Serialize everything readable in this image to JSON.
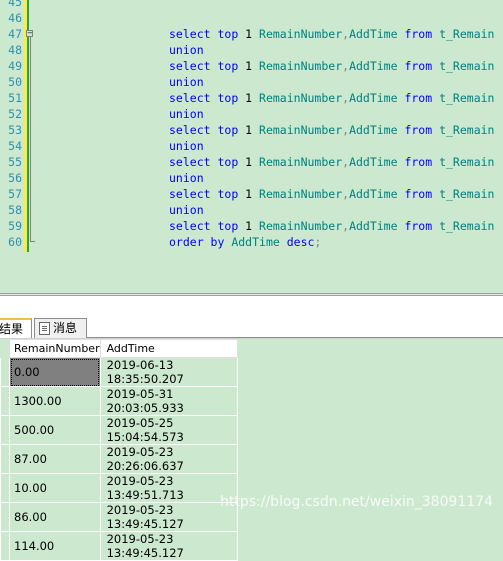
{
  "editor": {
    "lines": [
      {
        "n": "45",
        "tokens": []
      },
      {
        "n": "46",
        "tokens": []
      },
      {
        "n": "47",
        "tokens": [
          [
            "kw",
            "select "
          ],
          [
            "kw",
            "top "
          ],
          [
            "num",
            "1 "
          ],
          [
            "id",
            "RemainNumber"
          ],
          [
            "pl",
            ","
          ],
          [
            "id",
            "AddTime "
          ],
          [
            "kw",
            "from "
          ],
          [
            "id",
            "t_Remain"
          ]
        ]
      },
      {
        "n": "48",
        "tokens": [
          [
            "kw",
            "union"
          ]
        ]
      },
      {
        "n": "49",
        "tokens": [
          [
            "kw",
            "select "
          ],
          [
            "kw",
            "top "
          ],
          [
            "num",
            "1 "
          ],
          [
            "id",
            "RemainNumber"
          ],
          [
            "pl",
            ","
          ],
          [
            "id",
            "AddTime "
          ],
          [
            "kw",
            "from "
          ],
          [
            "id",
            "t_Remain"
          ]
        ]
      },
      {
        "n": "50",
        "tokens": [
          [
            "kw",
            "union"
          ]
        ]
      },
      {
        "n": "51",
        "tokens": [
          [
            "kw",
            "select "
          ],
          [
            "kw",
            "top "
          ],
          [
            "num",
            "1 "
          ],
          [
            "id",
            "RemainNumber"
          ],
          [
            "pl",
            ","
          ],
          [
            "id",
            "AddTime "
          ],
          [
            "kw",
            "from "
          ],
          [
            "id",
            "t_Remain"
          ]
        ]
      },
      {
        "n": "52",
        "tokens": [
          [
            "kw",
            "union"
          ]
        ]
      },
      {
        "n": "53",
        "tokens": [
          [
            "kw",
            "select "
          ],
          [
            "kw",
            "top "
          ],
          [
            "num",
            "1 "
          ],
          [
            "id",
            "RemainNumber"
          ],
          [
            "pl",
            ","
          ],
          [
            "id",
            "AddTime "
          ],
          [
            "kw",
            "from "
          ],
          [
            "id",
            "t_Remain"
          ]
        ]
      },
      {
        "n": "54",
        "tokens": [
          [
            "kw",
            "union"
          ]
        ]
      },
      {
        "n": "55",
        "tokens": [
          [
            "kw",
            "select "
          ],
          [
            "kw",
            "top "
          ],
          [
            "num",
            "1 "
          ],
          [
            "id",
            "RemainNumber"
          ],
          [
            "pl",
            ","
          ],
          [
            "id",
            "AddTime "
          ],
          [
            "kw",
            "from "
          ],
          [
            "id",
            "t_Remain"
          ]
        ]
      },
      {
        "n": "56",
        "tokens": [
          [
            "kw",
            "union"
          ]
        ]
      },
      {
        "n": "57",
        "tokens": [
          [
            "kw",
            "select "
          ],
          [
            "kw",
            "top "
          ],
          [
            "num",
            "1 "
          ],
          [
            "id",
            "RemainNumber"
          ],
          [
            "pl",
            ","
          ],
          [
            "id",
            "AddTime "
          ],
          [
            "kw",
            "from "
          ],
          [
            "id",
            "t_Remain"
          ]
        ]
      },
      {
        "n": "58",
        "tokens": [
          [
            "kw",
            "union"
          ]
        ]
      },
      {
        "n": "59",
        "tokens": [
          [
            "kw",
            "select "
          ],
          [
            "kw",
            "top "
          ],
          [
            "num",
            "1 "
          ],
          [
            "id",
            "RemainNumber"
          ],
          [
            "pl",
            ","
          ],
          [
            "id",
            "AddTime "
          ],
          [
            "kw",
            "from "
          ],
          [
            "id",
            "t_Remain"
          ]
        ]
      },
      {
        "n": "60",
        "tokens": [
          [
            "kw",
            "order "
          ],
          [
            "kw",
            "by "
          ],
          [
            "id",
            "AddTime "
          ],
          [
            "kw",
            "desc"
          ],
          [
            "pl",
            ";"
          ]
        ]
      }
    ]
  },
  "tabs": {
    "results_label": "结果",
    "messages_label": "消息",
    "messages_icon": "document-icon"
  },
  "grid": {
    "columns": [
      "RemainNumber",
      "AddTime"
    ],
    "rows": [
      [
        "0.00",
        "2019-06-13 18:35:50.207"
      ],
      [
        "1300.00",
        "2019-05-31 20:03:05.933"
      ],
      [
        "500.00",
        "2019-05-25 15:04:54.573"
      ],
      [
        "87.00",
        "2019-05-23 20:26:06.637"
      ],
      [
        "10.00",
        "2019-05-23 13:49:51.713"
      ],
      [
        "86.00",
        "2019-05-23 13:49:45.127"
      ],
      [
        "114.00",
        "2019-05-23 13:49:45.127"
      ]
    ]
  },
  "watermark": "https://blog.csdn.net/weixin_38091174",
  "colors": {
    "background": "#cce8cf",
    "keyword": "#0000ff",
    "identifier": "#008080",
    "line_number": "#2b91af",
    "selected_cell": "#808080"
  }
}
